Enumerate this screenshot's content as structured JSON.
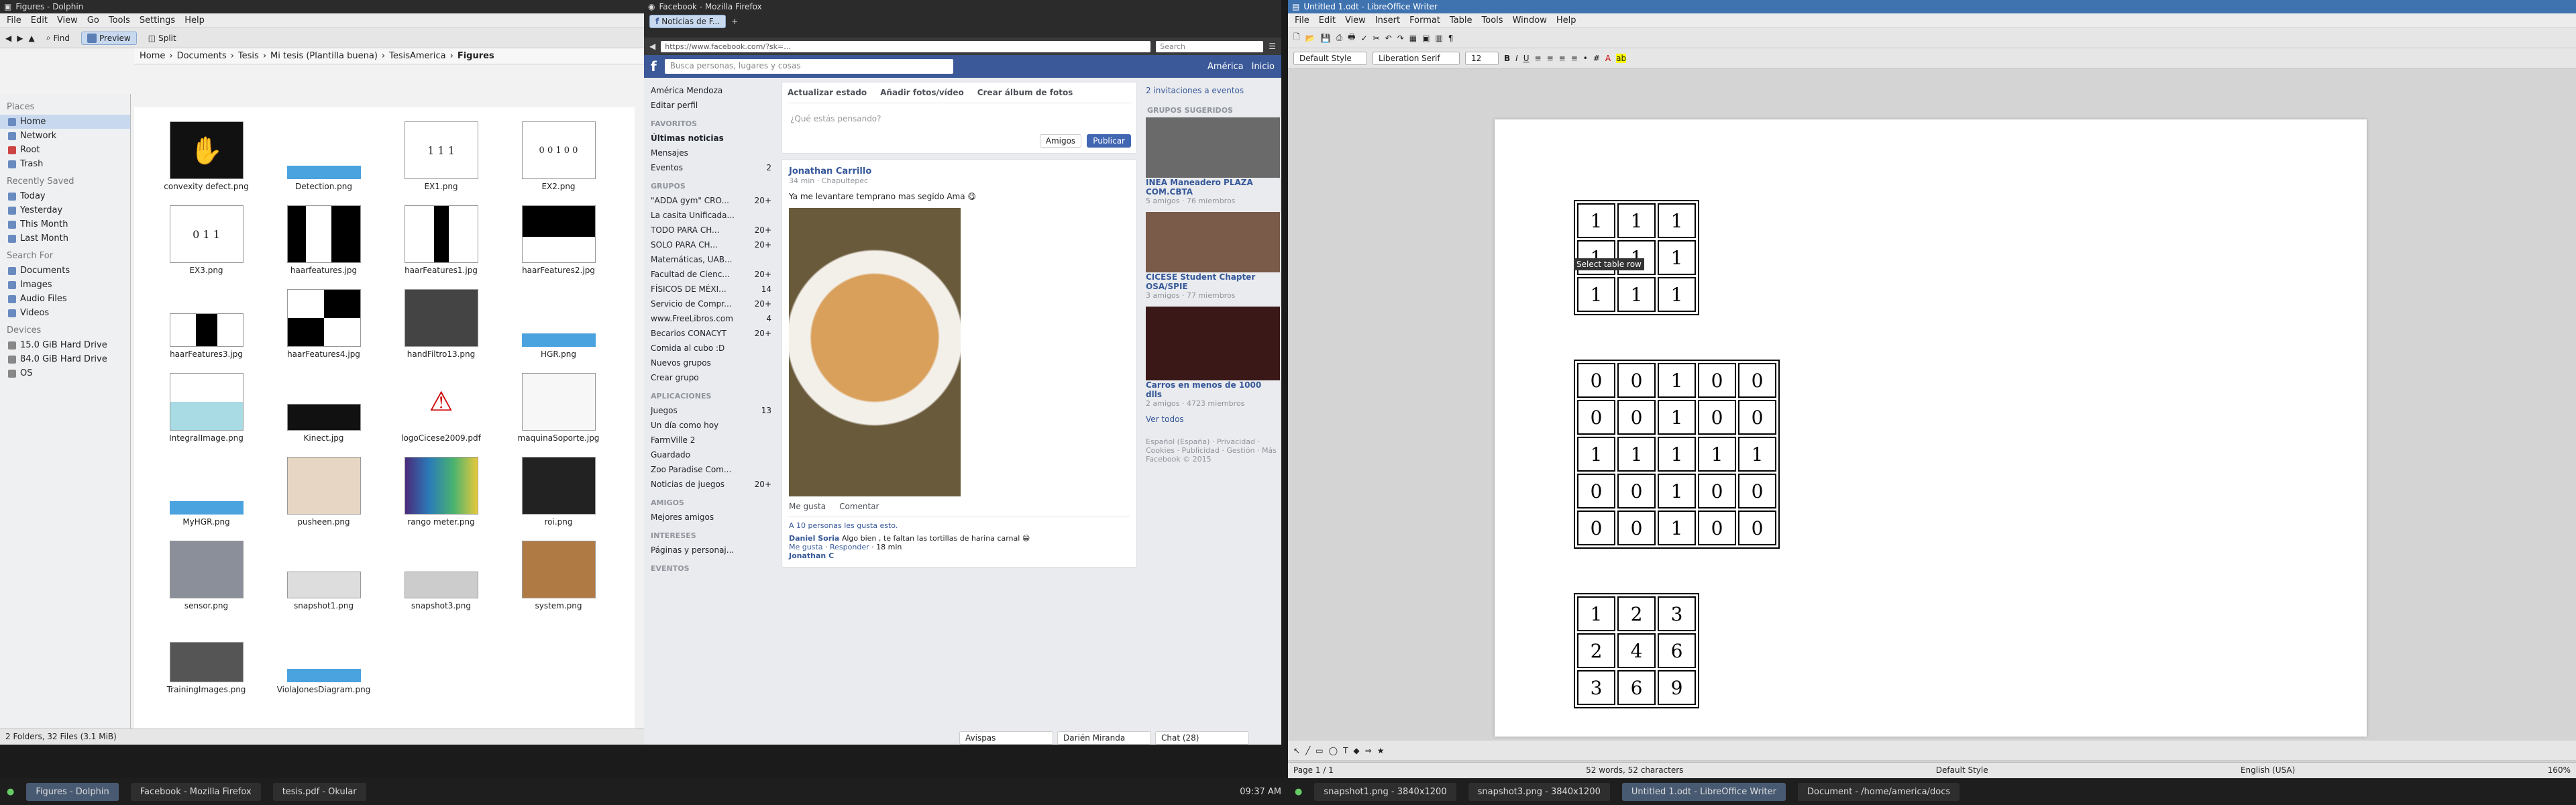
{
  "dolphin": {
    "title": "Figures - Dolphin",
    "menu": [
      "File",
      "Edit",
      "View",
      "Go",
      "Tools",
      "Settings",
      "Help"
    ],
    "toolbar": {
      "find": "Find",
      "preview": "Preview",
      "split": "Split"
    },
    "breadcrumb": [
      "Home",
      "Documents",
      "Tesis",
      "Mi tesis (Plantilla buena)",
      "TesisAmerica",
      "Figures"
    ],
    "places_header": "Places",
    "places": [
      "Home",
      "Network",
      "Root",
      "Trash"
    ],
    "recent_header": "Recently Saved",
    "recent": [
      "Today",
      "Yesterday",
      "This Month",
      "Last Month"
    ],
    "search_header": "Search For",
    "search": [
      "Documents",
      "Images",
      "Audio Files",
      "Videos"
    ],
    "devices_header": "Devices",
    "devices": [
      "15.0 GiB Hard Drive",
      "84.0 GiB Hard Drive",
      "OS"
    ],
    "files": [
      "convexity defect.png",
      "Detection.png",
      "EX1.png",
      "EX2.png",
      "EX3.png",
      "haarfeatures.jpg",
      "haarFeatures1.jpg",
      "haarFeatures2.jpg",
      "haarFeatures3.jpg",
      "haarFeatures4.jpg",
      "handFiltro13.png",
      "HGR.png",
      "IntegralImage.png",
      "Kinect.jpg",
      "logoCicese2009.pdf",
      "maquinaSoporte.jpg",
      "MyHGR.png",
      "pusheen.png",
      "rango meter.png",
      "roi.png",
      "sensor.png",
      "snapshot1.png",
      "snapshot3.png",
      "system.png",
      "TrainingImages.png",
      "ViolaJonesDiagram.png"
    ],
    "status": "2 Folders, 32 Files (3.1 MiB)"
  },
  "firefox": {
    "title": "Facebook - Mozilla Firefox",
    "tab": "Noticias de F...",
    "url": "https://www.facebook.com/?sk=...",
    "search_placeholder": "Search",
    "fb": {
      "search_placeholder": "Busca personas, lugares y cosas",
      "user": "América",
      "home": "Inicio",
      "left_user": "América Mendoza",
      "left_edit": "Editar perfil",
      "favorites_header": "FAVORITOS",
      "favorites": [
        {
          "label": "Últimas noticias",
          "count": ""
        },
        {
          "label": "Mensajes",
          "count": ""
        },
        {
          "label": "Eventos",
          "count": "2"
        }
      ],
      "groups_header": "GRUPOS",
      "groups": [
        {
          "label": "\"ADDA gym\" CRO...",
          "count": "20+"
        },
        {
          "label": "La casita Unificada...",
          "count": ""
        },
        {
          "label": "TODO PARA CH...",
          "count": "20+"
        },
        {
          "label": "SOLO PARA CH...",
          "count": "20+"
        },
        {
          "label": "Matemáticas, UAB...",
          "count": ""
        },
        {
          "label": "Facultad de Cienc...",
          "count": "20+"
        },
        {
          "label": "FÍSICOS DE MÉXI...",
          "count": "14"
        },
        {
          "label": "Servicio de Compr...",
          "count": "20+"
        },
        {
          "label": "www.FreeLibros.com",
          "count": "4"
        },
        {
          "label": "Becarios CONACYT",
          "count": "20+"
        },
        {
          "label": "Comida al cubo :D",
          "count": ""
        },
        {
          "label": "Nuevos grupos",
          "count": ""
        },
        {
          "label": "Crear grupo",
          "count": ""
        }
      ],
      "apps_header": "APLICACIONES",
      "apps": [
        {
          "label": "Juegos",
          "count": "13"
        },
        {
          "label": "Un día como hoy",
          "count": ""
        },
        {
          "label": "FarmVille 2",
          "count": ""
        },
        {
          "label": "Guardado",
          "count": ""
        },
        {
          "label": "Zoo Paradise Com...",
          "count": ""
        },
        {
          "label": "Noticias de juegos",
          "count": "20+"
        }
      ],
      "friends_header": "AMIGOS",
      "friends": "Mejores amigos",
      "interests_header": "INTERESES",
      "interests": "Páginas y personaj...",
      "events_header": "EVENTOS",
      "composer": {
        "status": "Actualizar estado",
        "photo": "Añadir fotos/vídeo",
        "album": "Crear álbum de fotos",
        "placeholder": "¿Qué estás pensando?",
        "audience": "Amigos",
        "publish": "Publicar"
      },
      "post": {
        "author": "Jonathan Carrillo",
        "meta": "34 min · Chapultepec",
        "text": "Ya me levantare temprano mas segido Ama 😋",
        "like": "Me gusta",
        "comment": "Comentar",
        "likes": "A 10 personas les gusta esto."
      },
      "comment": {
        "author": "Daniel Soria",
        "text": "Algo bien , te faltan las tortillas de harina carnal 😁",
        "like": "Me gusta",
        "reply": "Responder",
        "time": "18 min"
      },
      "comment2_author": "Jonathan C",
      "invites": "2 invitaciones a eventos",
      "suggested_header": "GRUPOS SUGERIDOS",
      "suggested": [
        {
          "name": "INEA Maneadero PLAZA COM.CBTA",
          "meta": "5 amigos · 76 miembros"
        },
        {
          "name": "CICESE Student Chapter OSA/SPIE",
          "meta": "3 amigos · 77 miembros"
        },
        {
          "name": "Carros en menos de 1000 dlls",
          "meta": "2 amigos · 4723 miembros"
        }
      ],
      "see_all": "Ver todos",
      "footer": "Español (España) · Privacidad · Cookies · Publicidad · Gestión · Más",
      "copyright": "Facebook © 2015",
      "chat_tabs": [
        "Avispas",
        "Darién Miranda",
        "Chat (28)"
      ]
    }
  },
  "writer": {
    "title": "Untitled 1.odt - LibreOffice Writer",
    "menu": [
      "File",
      "Edit",
      "View",
      "Insert",
      "Format",
      "Table",
      "Tools",
      "Window",
      "Help"
    ],
    "style": "Default Style",
    "font": "Liberation Serif",
    "size": "12",
    "tooltip": "Select table row",
    "table1": [
      [
        "1",
        "1",
        "1"
      ],
      [
        "1",
        "1",
        "1"
      ],
      [
        "1",
        "1",
        "1"
      ]
    ],
    "table2": [
      [
        "0",
        "0",
        "1",
        "0",
        "0"
      ],
      [
        "0",
        "0",
        "1",
        "0",
        "0"
      ],
      [
        "1",
        "1",
        "1",
        "1",
        "1"
      ],
      [
        "0",
        "0",
        "1",
        "0",
        "0"
      ],
      [
        "0",
        "0",
        "1",
        "0",
        "0"
      ]
    ],
    "table3": [
      [
        "1",
        "2",
        "3"
      ],
      [
        "2",
        "4",
        "6"
      ],
      [
        "3",
        "6",
        "9"
      ]
    ],
    "status": {
      "page": "Page 1 / 1",
      "words": "52 words, 52 characters",
      "style": "Default Style",
      "lang": "English (USA)",
      "zoom": "160%"
    }
  },
  "taskbar_left": [
    "Figures - Dolphin",
    "Facebook - Mozilla Firefox",
    "tesis.pdf - Okular"
  ],
  "taskbar_right": [
    "snapshot1.png - 3840x1200",
    "snapshot3.png - 3840x1200",
    "Untitled 1.odt - LibreOffice Writer",
    "Document - /home/america/docs"
  ],
  "clock": "09:37 AM"
}
